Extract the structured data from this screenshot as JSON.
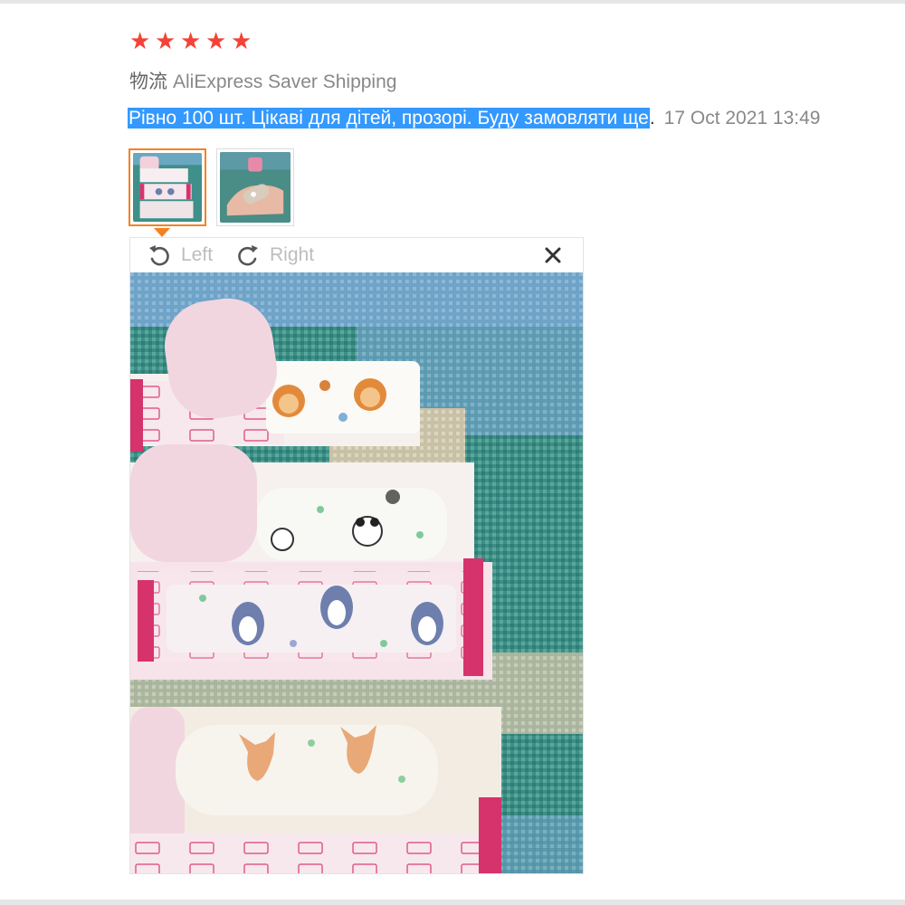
{
  "rating": {
    "stars": 5,
    "color": "#f44336"
  },
  "logistics": {
    "label": "物流",
    "value": "AliExpress Saver Shipping"
  },
  "review": {
    "text": "Рівно 100 шт. Цікаві для дітей, прозорі. Буду замовляти ще",
    "punct": ".",
    "date": "17 Oct 2021 13:49"
  },
  "thumbnails": [
    {
      "name": "review-photo-1",
      "selected": true
    },
    {
      "name": "review-photo-2",
      "selected": false
    }
  ],
  "viewer": {
    "rotate_left_label": "Left",
    "rotate_right_label": "Right",
    "close_icon": "close-icon",
    "photo_subject": "children's adhesive bandages with lion, panda, penguin and fox prints on a teal striped cloth"
  },
  "colors": {
    "accent": "#f58220",
    "selection": "#3399ff",
    "muted": "#888888"
  }
}
